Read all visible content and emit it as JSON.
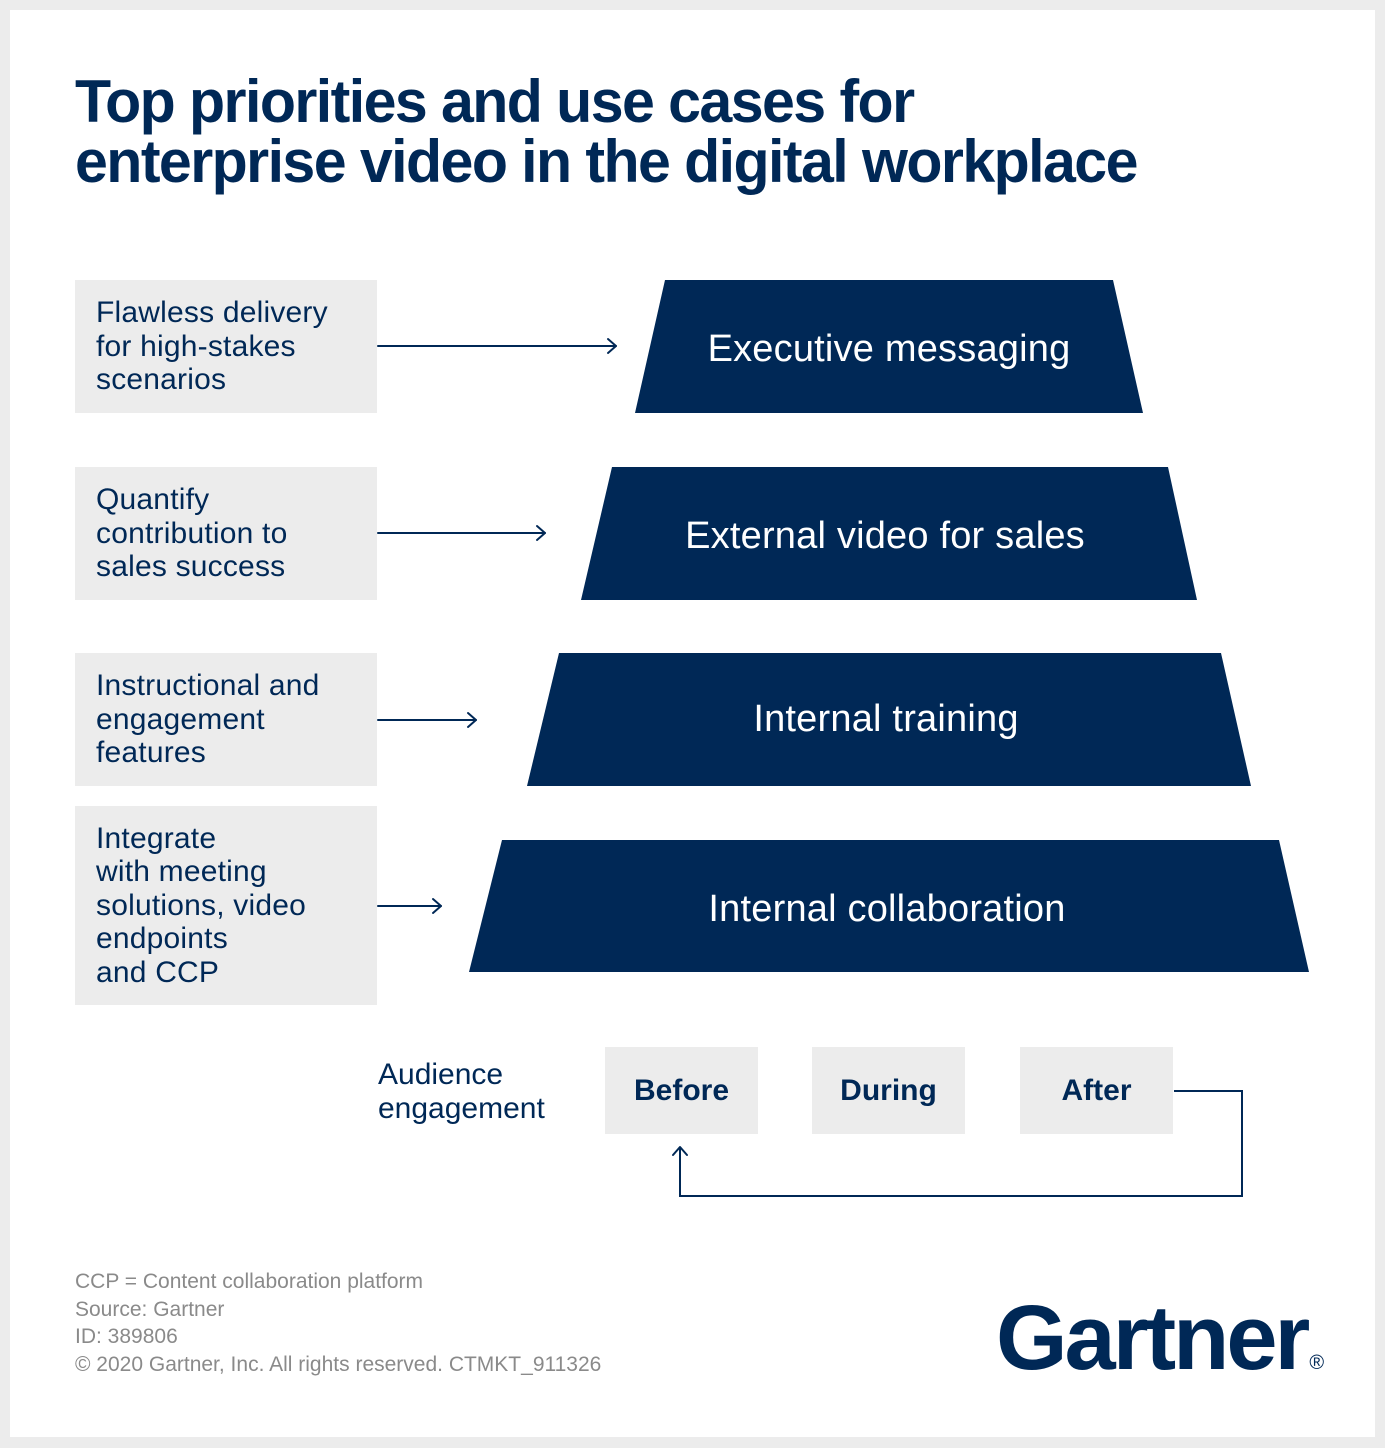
{
  "title": {
    "line1": "Top priorities and use cases for",
    "line2": "enterprise video in the digital workplace"
  },
  "colors": {
    "navy": "#002856",
    "box_gray": "#ececec",
    "page_bg": "#ececec",
    "footnote_gray": "#8a8a8a"
  },
  "tiers": [
    {
      "use_case": "Executive messaging",
      "priority_lines": [
        "Flawless delivery",
        "for high-stakes",
        "scenarios"
      ]
    },
    {
      "use_case": "External video for sales",
      "priority_lines": [
        "Quantify",
        "contribution to",
        "sales success"
      ]
    },
    {
      "use_case": "Internal training",
      "priority_lines": [
        "Instructional and",
        "engagement",
        "features"
      ]
    },
    {
      "use_case": "Internal collaboration",
      "priority_lines": [
        "Integrate",
        "with meeting",
        "solutions, video",
        "endpoints",
        "and CCP"
      ]
    }
  ],
  "audience_engagement": {
    "label_lines": [
      "Audience",
      "engagement"
    ],
    "phases": [
      "Before",
      "During",
      "After"
    ],
    "loop_icon": "loop-back-arrow-icon"
  },
  "footnotes": [
    "CCP = Content collaboration platform",
    "Source: Gartner",
    "ID: 389806",
    "© 2020 Gartner, Inc. All rights reserved. CTMKT_911326"
  ],
  "logo": {
    "text": "Gartner",
    "mark": "®"
  }
}
